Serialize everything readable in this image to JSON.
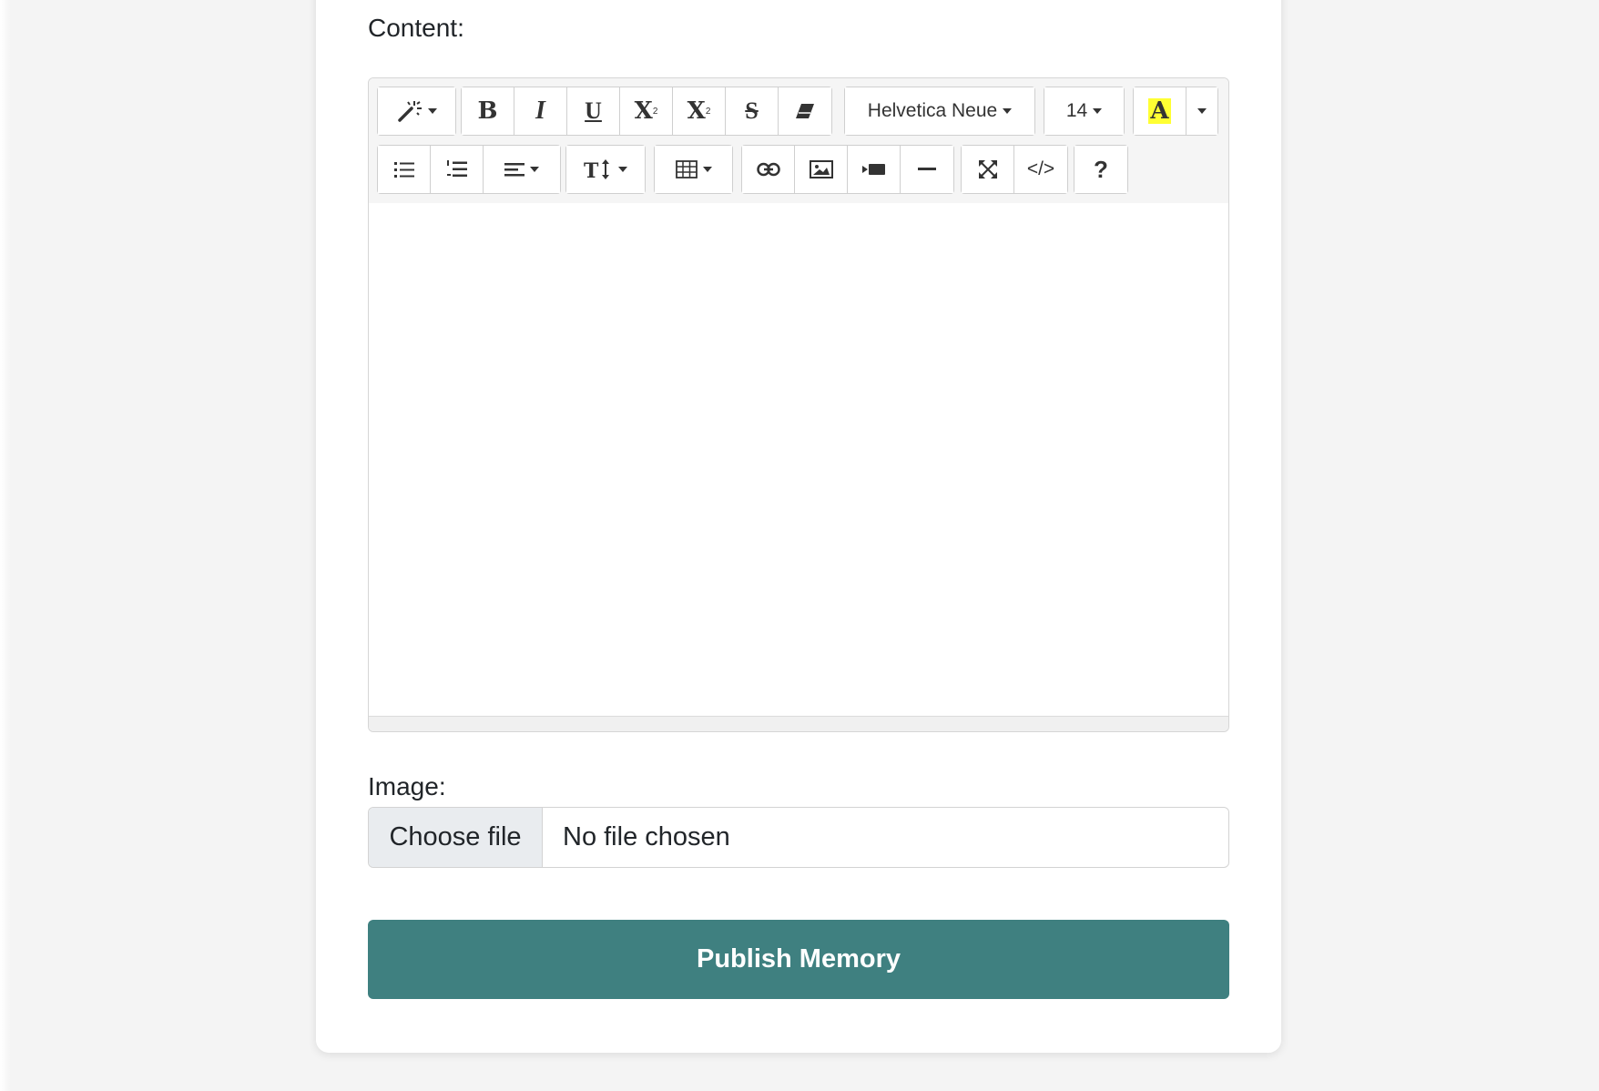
{
  "content_label": "Content:",
  "image_label": "Image:",
  "toolbar": {
    "font_family": "Helvetica Neue",
    "font_size": "14",
    "bold": "B",
    "italic": "I",
    "underline": "U",
    "superscript_base": "X",
    "superscript_mark": "2",
    "subscript_base": "X",
    "subscript_mark": "2",
    "strikethrough": "S",
    "forecolor": "A",
    "code_view": "</>",
    "help": "?",
    "icons": [
      "magic-icon",
      "eraser-icon",
      "unordered-list-icon",
      "ordered-list-icon",
      "align-icon",
      "line-height-icon",
      "table-icon",
      "link-icon",
      "picture-icon",
      "video-icon",
      "horizontal-rule-icon",
      "fullscreen-icon"
    ],
    "highlight_color": "#ffff33"
  },
  "file_input": {
    "button_label": "Choose file",
    "status": "No file chosen"
  },
  "submit": {
    "label": "Publish Memory",
    "color": "#3f8080"
  }
}
